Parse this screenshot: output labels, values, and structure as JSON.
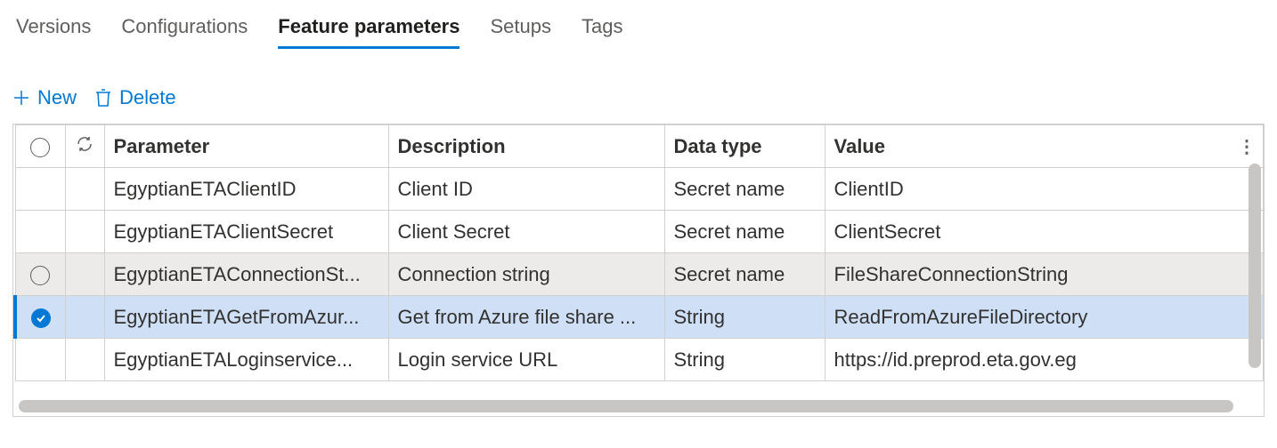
{
  "tabs": [
    {
      "label": "Versions",
      "active": false
    },
    {
      "label": "Configurations",
      "active": false
    },
    {
      "label": "Feature parameters",
      "active": true
    },
    {
      "label": "Setups",
      "active": false
    },
    {
      "label": "Tags",
      "active": false
    }
  ],
  "toolbar": {
    "new_label": "New",
    "delete_label": "Delete"
  },
  "columns": {
    "parameter": "Parameter",
    "description": "Description",
    "data_type": "Data type",
    "value": "Value"
  },
  "rows": [
    {
      "parameter": "EgyptianETAClientID",
      "description": "Client ID",
      "data_type": "Secret name",
      "value": "ClientID",
      "state": "normal"
    },
    {
      "parameter": "EgyptianETAClientSecret",
      "description": "Client Secret",
      "data_type": "Secret name",
      "value": "ClientSecret",
      "state": "normal"
    },
    {
      "parameter": "EgyptianETAConnectionSt...",
      "description": "Connection string",
      "data_type": "Secret name",
      "value": "FileShareConnectionString",
      "state": "hover"
    },
    {
      "parameter": "EgyptianETAGetFromAzur...",
      "description": "Get from Azure file share ...",
      "data_type": "String",
      "value": "ReadFromAzureFileDirectory",
      "state": "selected"
    },
    {
      "parameter": "EgyptianETALoginservice...",
      "description": "Login service URL",
      "data_type": "String",
      "value": "https://id.preprod.eta.gov.eg",
      "state": "normal"
    }
  ],
  "icons": {
    "plus": "plus-icon",
    "trash": "trash-icon",
    "refresh": "refresh-icon",
    "select_circle": "select-circle-icon",
    "check": "check-icon",
    "more": "more-icon"
  }
}
